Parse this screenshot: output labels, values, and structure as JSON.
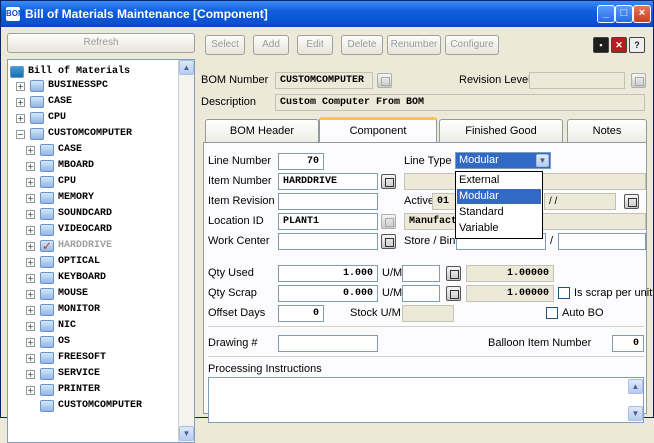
{
  "window": {
    "title": "Bill of Materials Maintenance [Component]",
    "app_icon_text": "BOM"
  },
  "left_panel": {
    "refresh_label": "Refresh",
    "tree": {
      "root": "Bill of Materials",
      "level1": [
        "BUSINESSPC",
        "CASE",
        "CPU",
        "CUSTOMCOMPUTER"
      ],
      "children": [
        "CASE",
        "MBOARD",
        "CPU",
        "MEMORY",
        "SOUNDCARD",
        "VIDEOCARD",
        "HARDDRIVE",
        "OPTICAL",
        "KEYBOARD",
        "MOUSE",
        "MONITOR",
        "NIC",
        "OS",
        "FREESOFT",
        "SERVICE",
        "PRINTER",
        "CUSTOMCOMPUTER"
      ]
    }
  },
  "toolbar": {
    "select": "Select",
    "add": "Add",
    "edit": "Edit",
    "delete": "Delete",
    "renumber": "Renumber",
    "configure": "Configure"
  },
  "header": {
    "bom_number_label": "BOM Number",
    "bom_number_value": "CUSTOMCOMPUTER",
    "revision_label": "Revision Level",
    "revision_value": "",
    "description_label": "Description",
    "description_value": "Custom Computer From BOM"
  },
  "tabs": [
    "BOM Header",
    "Component",
    "Finished Good",
    "Notes"
  ],
  "active_tab": "Component",
  "component": {
    "line_number_label": "Line Number",
    "line_number_value": "70",
    "item_number_label": "Item Number",
    "item_number_value": "HARDDRIVE",
    "item_revision_label": "Item Revision",
    "item_revision_value": "",
    "location_label": "Location ID",
    "location_value": "PLANT1",
    "work_center_label": "Work Center",
    "work_center_value": "",
    "line_type_label": "Line Type",
    "line_type_value": "Modular",
    "line_type_options": [
      "External",
      "Modular",
      "Standard",
      "Variable"
    ],
    "active_label": "Active",
    "active_value": "01",
    "date_value": "/ /",
    "manufact_value": "Manufact",
    "store_bin_label": "Store / Bin",
    "bin_sep": "/",
    "qty_used_label": "Qty Used",
    "qty_used_value": "1.000",
    "qty_used_um_label": "U/M",
    "qty_used_conv": "1.00000",
    "qty_scrap_label": "Qty Scrap",
    "qty_scrap_value": "0.000",
    "qty_scrap_um_label": "U/M",
    "qty_scrap_conv": "1.00000",
    "scrap_per_unit_label": "Is scrap per unit?",
    "offset_days_label": "Offset Days",
    "offset_days_value": "0",
    "stock_um_label": "Stock U/M",
    "auto_bo_label": "Auto BO",
    "drawing_label": "Drawing #",
    "balloon_label": "Balloon Item Number",
    "balloon_value": "0",
    "processing_label": "Processing Instructions"
  }
}
